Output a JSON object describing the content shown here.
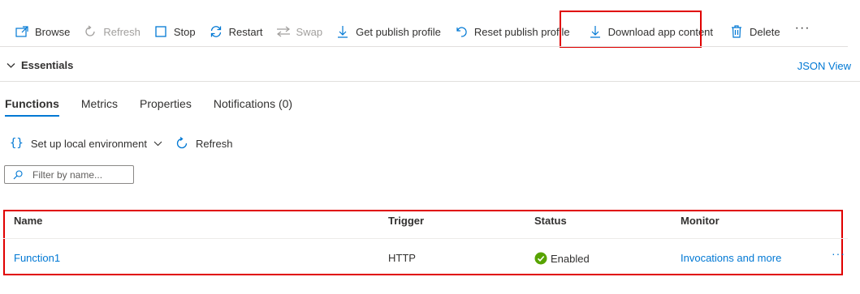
{
  "toolbar": {
    "browse": "Browse",
    "refresh": "Refresh",
    "stop": "Stop",
    "restart": "Restart",
    "swap": "Swap",
    "get_publish_profile": "Get publish profile",
    "reset_publish_profile": "Reset publish profile",
    "download_app_content": "Download app content",
    "delete": "Delete",
    "more": "···"
  },
  "essentials": {
    "label": "Essentials",
    "json_view": "JSON View"
  },
  "tabs": [
    {
      "label": "Functions",
      "active": true
    },
    {
      "label": "Metrics",
      "active": false
    },
    {
      "label": "Properties",
      "active": false
    },
    {
      "label": "Notifications (0)",
      "active": false
    }
  ],
  "subbar": {
    "setup_label": "Set up local environment",
    "refresh_label": "Refresh"
  },
  "filter": {
    "placeholder": "Filter by name..."
  },
  "table": {
    "headers": [
      "Name",
      "Trigger",
      "Status",
      "Monitor"
    ],
    "rows": [
      {
        "name": "Function1",
        "trigger": "HTTP",
        "status": "Enabled",
        "monitor": "Invocations and more",
        "more": "···"
      }
    ]
  },
  "colors": {
    "accent": "#0078d4",
    "highlight": "#e00000",
    "success": "#57a300"
  }
}
